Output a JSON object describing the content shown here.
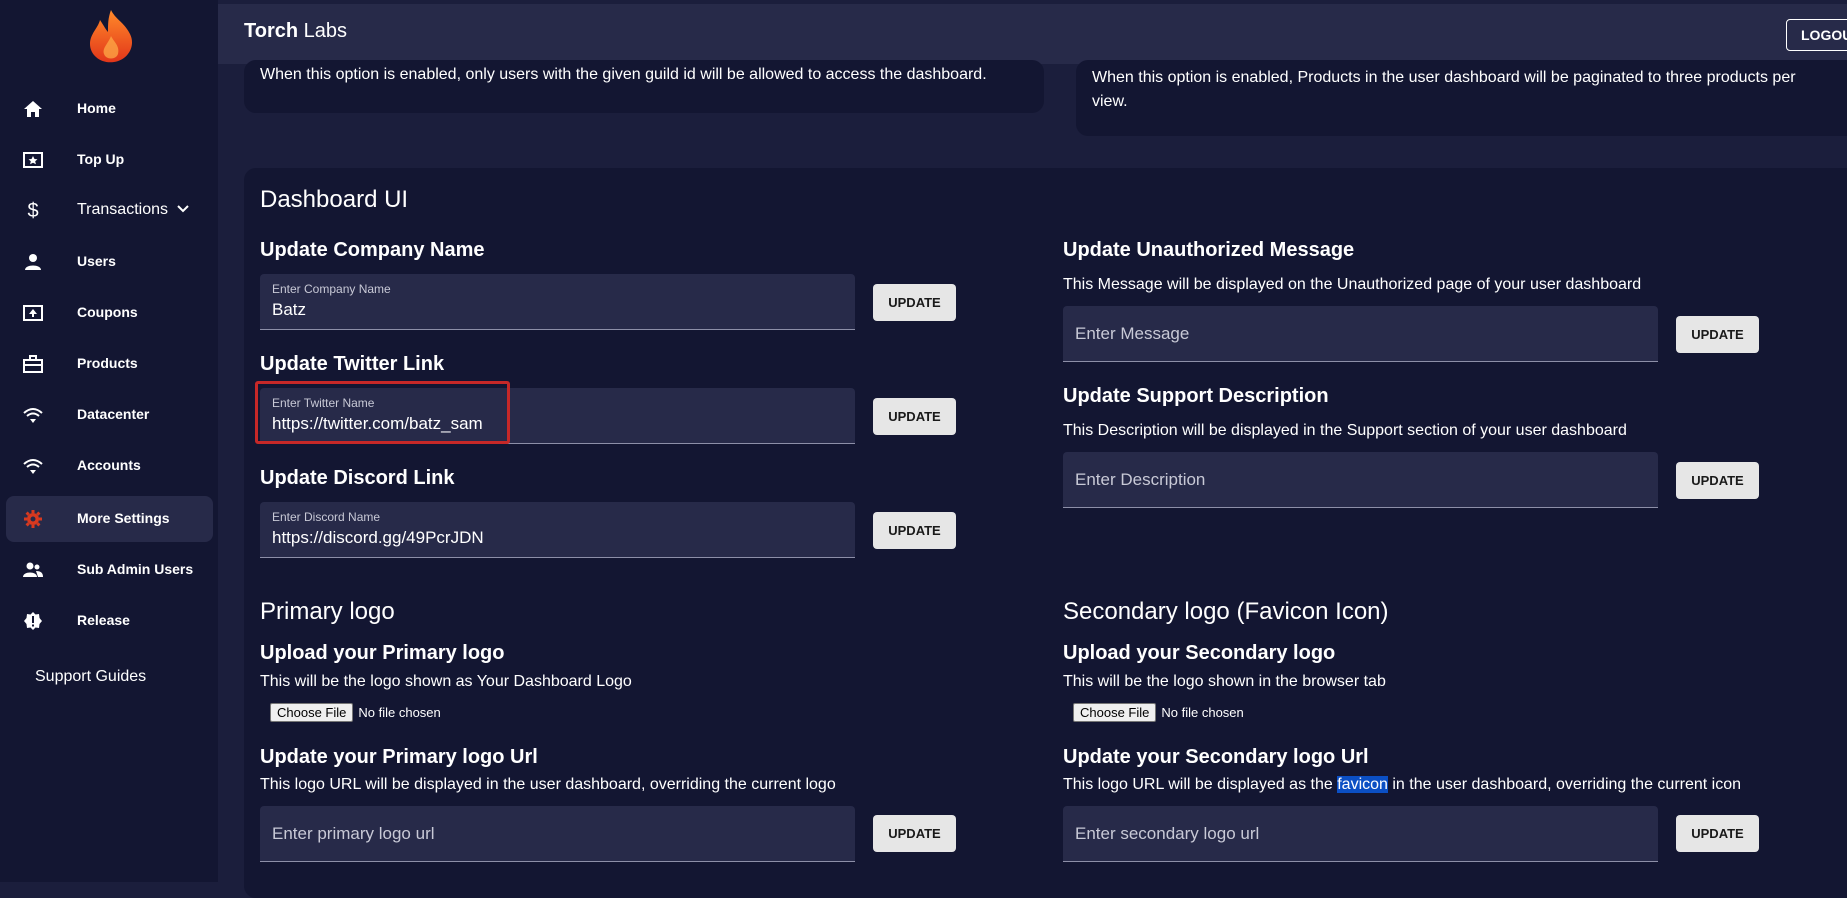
{
  "app": {
    "brand_bold": "Torch",
    "brand_rest": " Labs",
    "logout_label": "LOGOUT"
  },
  "sidebar": {
    "items": [
      {
        "label": "Home",
        "icon": "home-icon"
      },
      {
        "label": "Top Up",
        "icon": "star-card-icon"
      },
      {
        "label": "Transactions",
        "icon": "dollar-icon"
      },
      {
        "label": "Users",
        "icon": "user-icon"
      },
      {
        "label": "Coupons",
        "icon": "coupon-icon"
      },
      {
        "label": "Products",
        "icon": "briefcase-icon"
      },
      {
        "label": "Datacenter",
        "icon": "wifi-icon"
      },
      {
        "label": "Accounts",
        "icon": "wifi-icon"
      },
      {
        "label": "More Settings",
        "icon": "gear-icon"
      },
      {
        "label": "Sub Admin Users",
        "icon": "group-icon"
      },
      {
        "label": "Release",
        "icon": "alert-badge-icon"
      }
    ],
    "support_label": "Support Guides",
    "active_color": "#d8391f"
  },
  "top_cards": {
    "left_text": "When this option is enabled, only users with the given guild id will be allowed to access the dashboard.",
    "right_text": "When this option is enabled, Products in the user dashboard will be paginated to three products per view."
  },
  "dashboard_ui": {
    "title": "Dashboard UI",
    "company": {
      "heading": "Update Company Name",
      "label": "Enter Company Name",
      "value": "Batz",
      "button": "UPDATE"
    },
    "twitter": {
      "heading": "Update Twitter Link",
      "label": "Enter Twitter Name",
      "value": "https://twitter.com/batz_sam",
      "button": "UPDATE"
    },
    "discord": {
      "heading": "Update Discord Link",
      "label": "Enter Discord Name",
      "value": "https://discord.gg/49PcrJDN",
      "button": "UPDATE"
    },
    "unauth": {
      "heading": "Update Unauthorized Message",
      "desc": "This Message will be displayed on the Unauthorized page of your user dashboard",
      "placeholder": "Enter Message",
      "button": "UPDATE"
    },
    "support": {
      "heading": "Update Support Description",
      "desc": "This Description will be displayed in the Support section of your user dashboard",
      "placeholder": "Enter Description",
      "button": "UPDATE"
    },
    "primary": {
      "title": "Primary logo",
      "upload_heading": "Upload your Primary logo",
      "upload_desc": "This will be the logo shown as Your Dashboard Logo",
      "choose": "Choose File",
      "nofile": "No file chosen",
      "url_heading": "Update your Primary logo Url",
      "url_desc": "This logo URL will be displayed in the user dashboard, overriding the current logo",
      "placeholder": "Enter primary logo url",
      "button": "UPDATE"
    },
    "secondary": {
      "title": "Secondary logo (Favicon Icon)",
      "upload_heading": "Upload your Secondary logo",
      "upload_desc": "This will be the logo shown in the browser tab",
      "choose": "Choose File",
      "nofile": "No file chosen",
      "url_heading": "Update your Secondary logo Url",
      "url_desc_pre": "This logo URL will be displayed as the ",
      "url_desc_sel": "favicon",
      "url_desc_post": " in the user dashboard, overriding the current icon",
      "placeholder": "Enter secondary logo url",
      "button": "UPDATE"
    }
  }
}
